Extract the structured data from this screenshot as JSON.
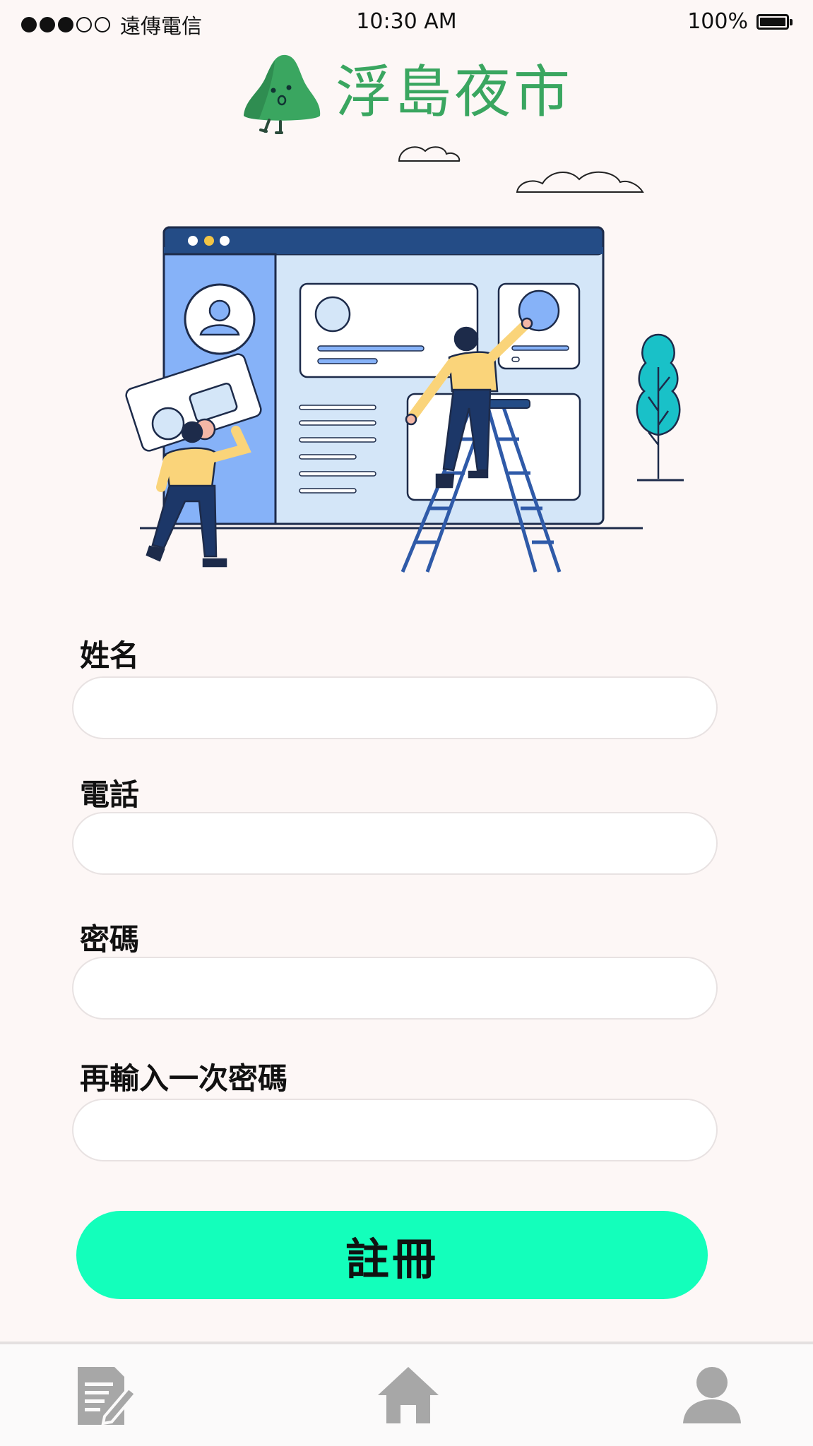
{
  "status_bar": {
    "carrier": "遠傳電信",
    "time": "10:30 AM",
    "battery": "100%",
    "signal_strength": "3 of 5"
  },
  "app": {
    "name": "浮島夜市",
    "brand_color": "#3aa660"
  },
  "form": {
    "name_label": "姓名",
    "phone_label": "電話",
    "password_label": "密碼",
    "confirm_password_label": "再輸入一次密碼",
    "submit_label": "註冊",
    "submit_color": "#13ffbb"
  },
  "bottom_nav": {
    "items": [
      {
        "icon": "document-edit-icon"
      },
      {
        "icon": "home-icon"
      },
      {
        "icon": "user-icon"
      }
    ]
  }
}
